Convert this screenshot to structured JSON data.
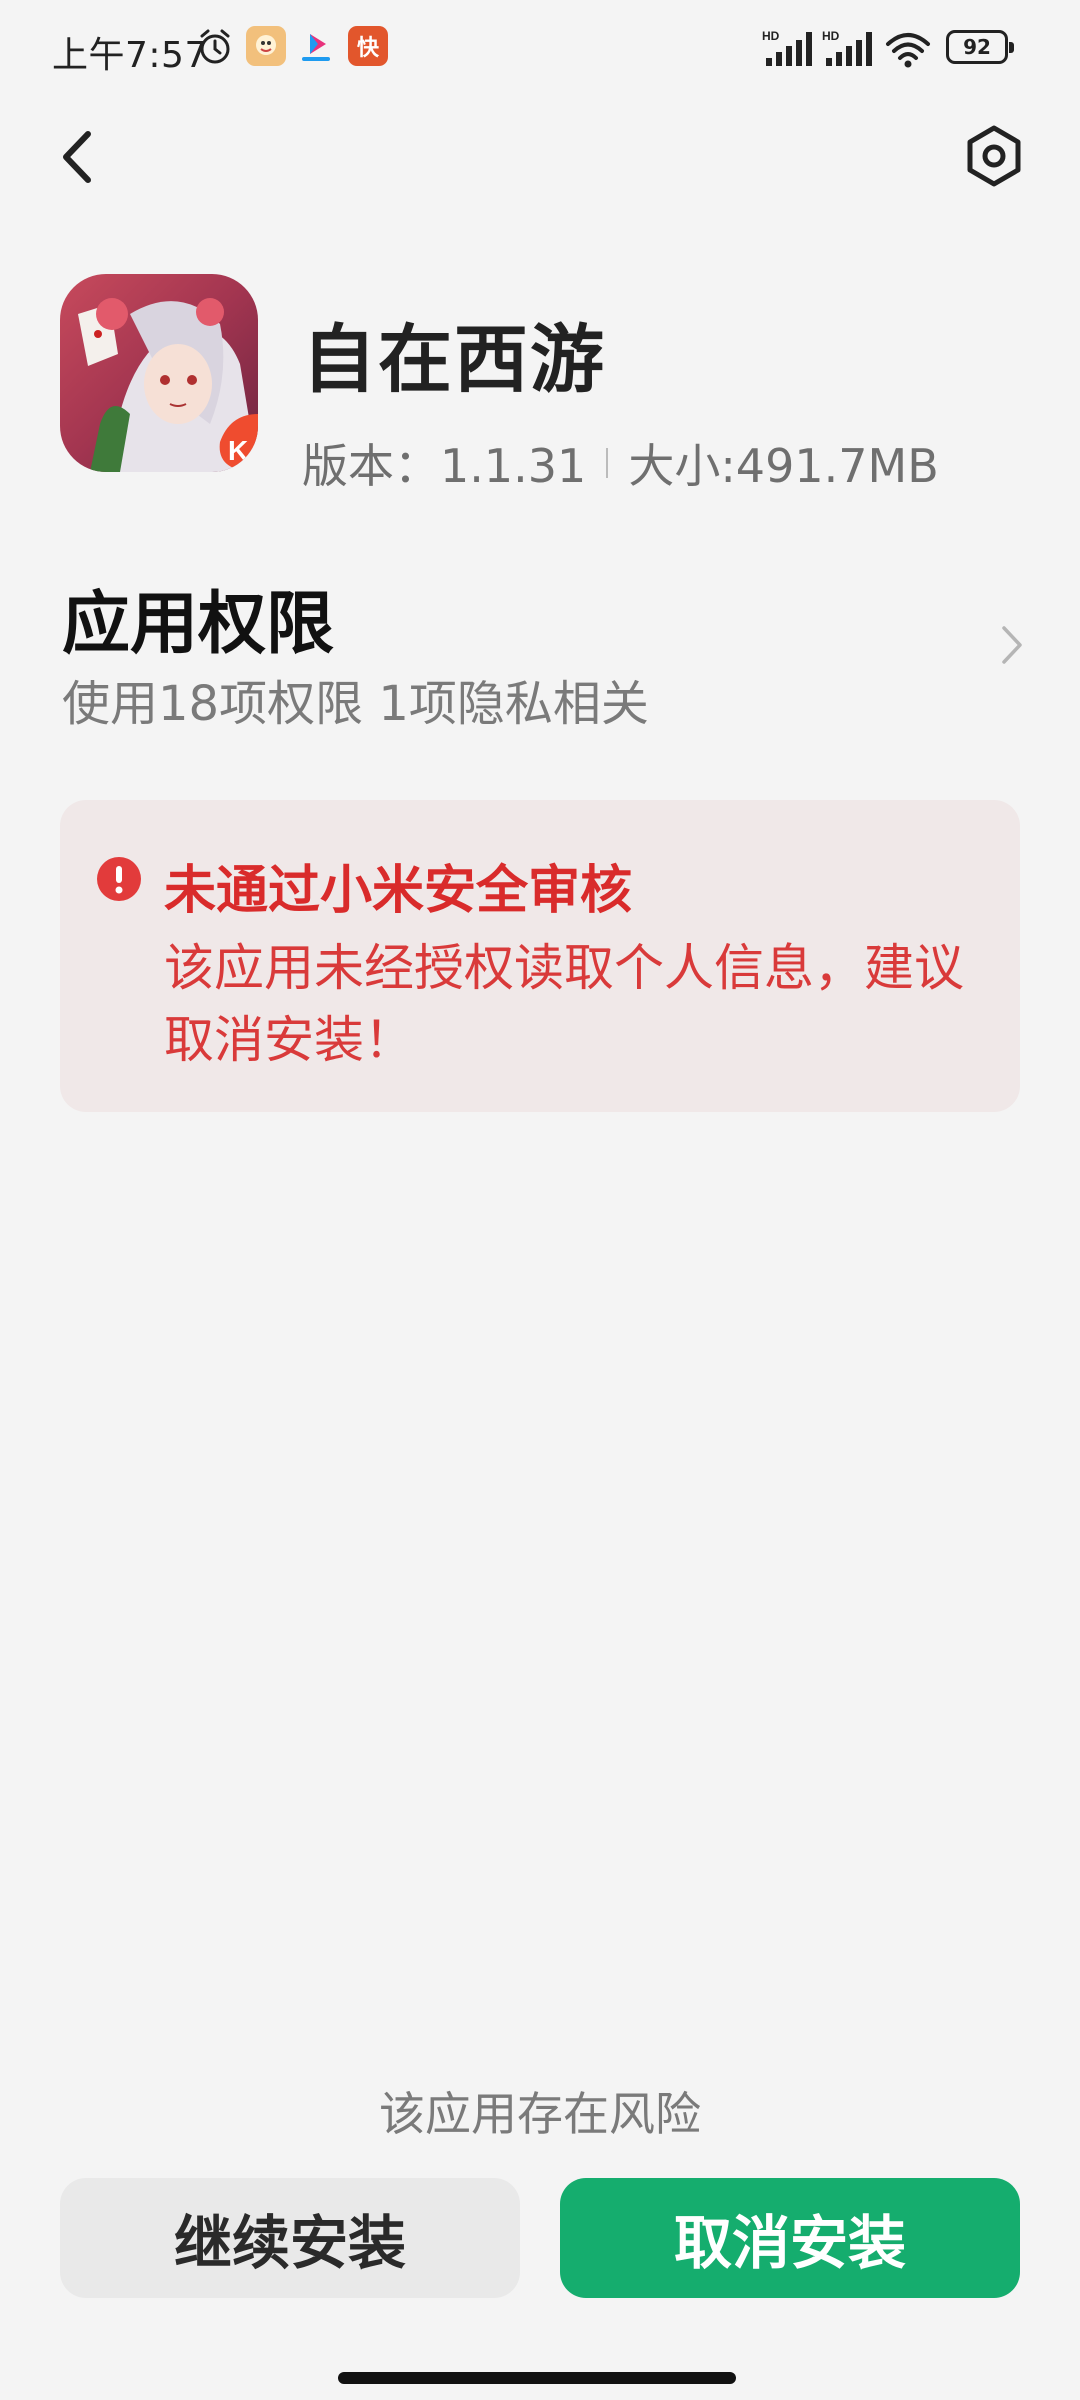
{
  "status_bar": {
    "time": "上午7:57",
    "alarm_icon": "alarm-clock-icon",
    "notification_icons": [
      "game-notification-icon",
      "youku-icon",
      "kuaishou-icon"
    ],
    "kuaishou_glyph": "快",
    "signal_label_1": "HD",
    "signal_label_2": "HD",
    "battery_level": "92"
  },
  "header": {
    "back_icon": "chevron-left-icon",
    "settings_icon": "settings-hexagon-icon"
  },
  "app": {
    "name": "自在西游",
    "version": "版本：1.1.31",
    "size": "大小:491.7MB"
  },
  "permissions": {
    "title": "应用权限",
    "summary": "使用18项权限 1项隐私相关"
  },
  "warning": {
    "title": "未通过小米安全审核",
    "body": "该应用未经授权读取个人信息，建议取消安装！",
    "color": "#d92b2b",
    "background": "#f0e8e8"
  },
  "footer": {
    "risk_note": "该应用存在风险",
    "continue_label": "继续安装",
    "cancel_label": "取消安装",
    "cancel_color": "#15ad6e"
  }
}
